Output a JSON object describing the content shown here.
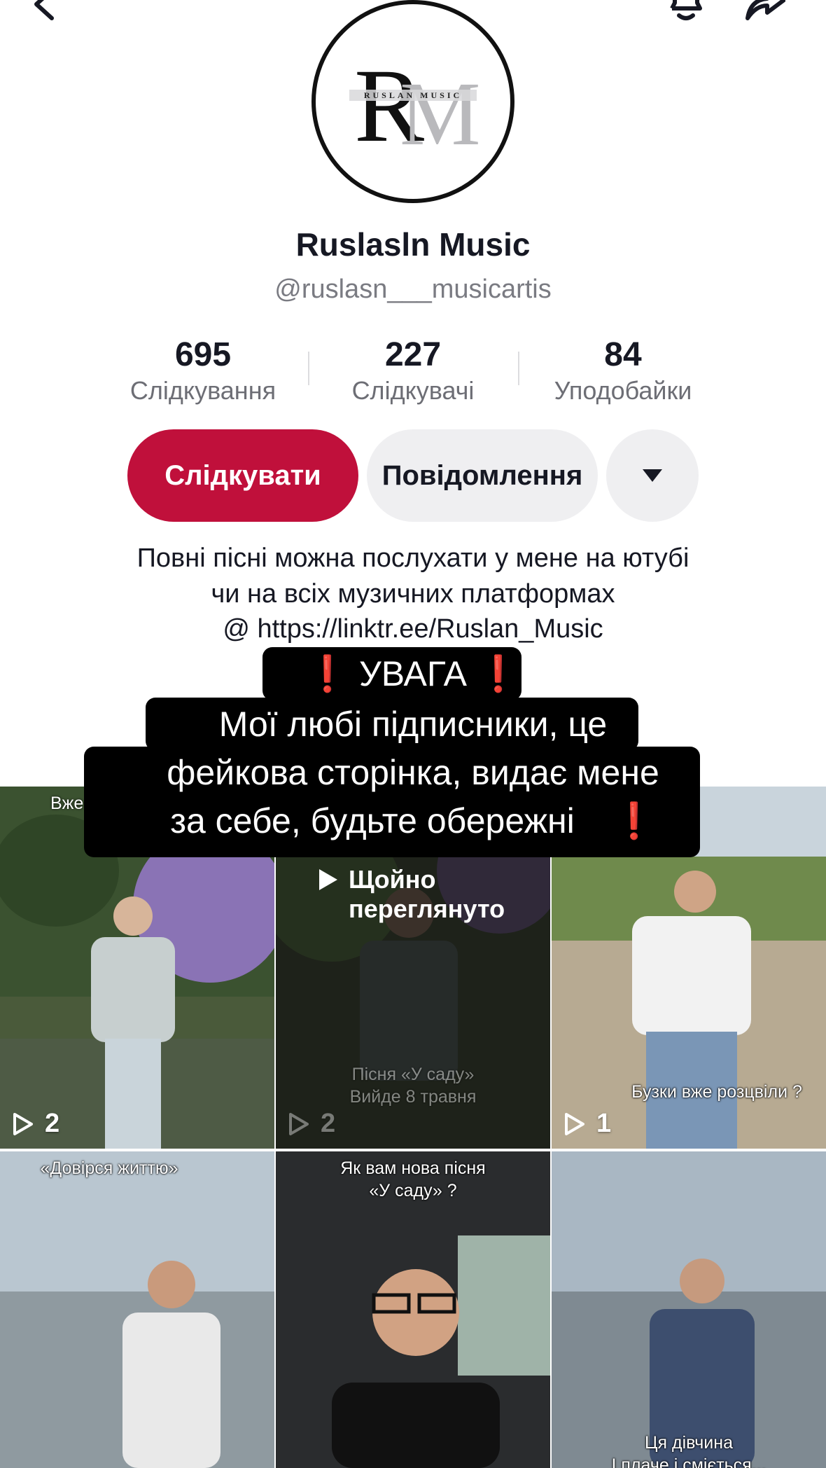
{
  "top_bar": {
    "back_icon": "chevron-left-icon",
    "bell_icon": "bell-icon",
    "share_icon": "share-arrow-icon"
  },
  "profile": {
    "avatar_logo_text": "RUSLAN MUSIC",
    "display_name": "Ruslasln Music",
    "username": "@ruslasn___musicartis"
  },
  "stats": [
    {
      "value": "695",
      "label": "Слідкування"
    },
    {
      "value": "227",
      "label": "Слідкувачі"
    },
    {
      "value": "84",
      "label": "Уподобайки"
    }
  ],
  "actions": {
    "follow_label": "Слідкувати",
    "message_label": "Повідомлення",
    "more_icon": "caret-down-icon"
  },
  "bio": {
    "line1": "Повні пісні можна послухати у мене на ютубі",
    "line2": "чи на всіх музичних платформах",
    "line3": "@ https://linktr.ee/Ruslan_Music"
  },
  "warning": {
    "title": "УВАГА",
    "excl": "❗",
    "line1": "Мої любі підписники, це",
    "line2": "фейкова сторінка, видає мене",
    "line3": "за себе, будьте обережні"
  },
  "videos": [
    {
      "count": "2",
      "caption": "Вже"
    },
    {
      "count": "2",
      "overlay": "Щойно\nпереглянуто",
      "overlay_line1": "Щойно",
      "overlay_line2": "переглянуто",
      "caption_line1": "Пісня «У саду»",
      "caption_line2": "Вийде 8 травня"
    },
    {
      "count": "1",
      "caption": "Бузки вже розцвіли ?"
    },
    {
      "caption": "«Довірся життю»"
    },
    {
      "caption_line1": "Як вам нова пісня",
      "caption_line2": "«У саду» ?"
    },
    {
      "caption_line1": "Ця дівчина",
      "caption_line2": "І плаче і сміється..."
    }
  ],
  "colors": {
    "follow_button": "#c0103b",
    "secondary_button": "#efeff1",
    "warning_background": "#000000",
    "exclamation": "#e21d2b"
  }
}
